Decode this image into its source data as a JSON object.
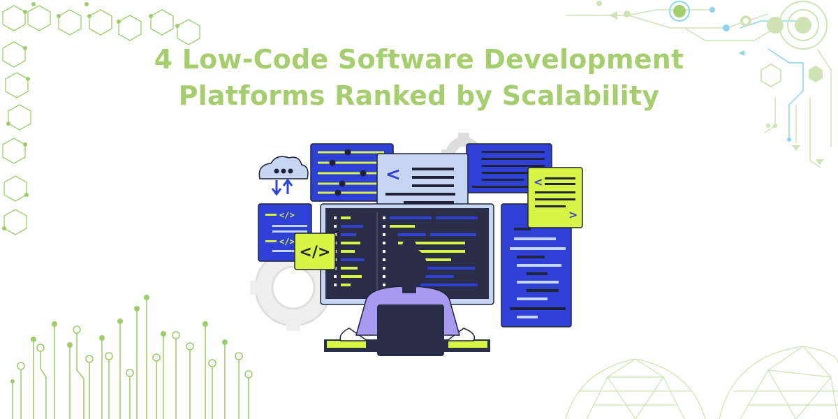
{
  "title": {
    "line1": "4 Low-Code Software Development",
    "line2": "Platforms Ranked by Scalability"
  },
  "illustration": {
    "code_tag_label": "</>",
    "angle_left": "<",
    "angle_right": ">"
  },
  "colors": {
    "title": "#a6ce6f",
    "decor_green": "#9fcb6a",
    "decor_light_green": "#cfe3b4",
    "decor_blue": "#8ad6e8",
    "panel_blue": "#2f40d6",
    "monitor_dark": "#2a2d48",
    "accent_lime": "#d8f545",
    "light_blue": "#c6d6f2",
    "gear_gray": "#dedede",
    "person_purple": "#a89af0",
    "outline_dark": "#1f2238"
  },
  "icons": [
    "cloud-sync-icon",
    "gear-icon",
    "code-tag-icon",
    "hexagon-network-icon",
    "circuit-trace-icon",
    "geodesic-globe-icon"
  ]
}
